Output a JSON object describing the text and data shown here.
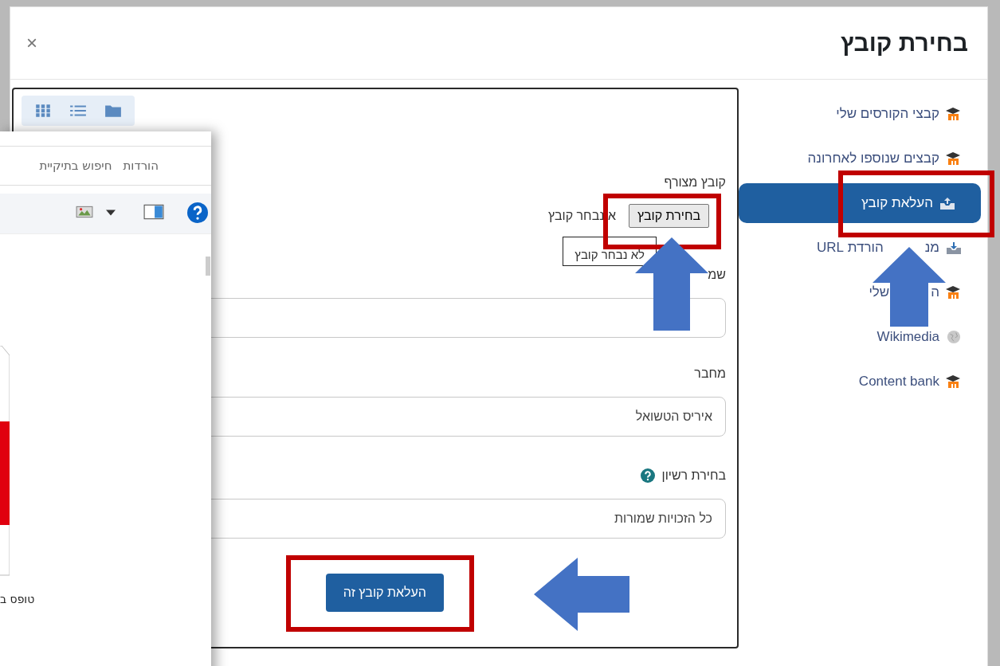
{
  "dialog": {
    "title": "בחירת קובץ",
    "close": "×"
  },
  "sidebar": [
    {
      "parts": [
        "קבצי הקורסים שלי"
      ],
      "kind": "hat",
      "selected": false
    },
    {
      "parts": [
        "קבצים שנוספו לאחרונה"
      ],
      "kind": "hat",
      "selected": false
    },
    {
      "parts": [
        "העלאת קובץ"
      ],
      "kind": "upload",
      "selected": true
    },
    {
      "parts": [
        "מנ",
        "הורדת URL"
      ],
      "kind": "download",
      "selected": false
    },
    {
      "parts": [
        "ה",
        "שלי"
      ],
      "kind": "hat",
      "selected": false
    },
    {
      "parts": [
        "Wikimedia"
      ],
      "kind": "globe",
      "selected": false
    },
    {
      "parts": [
        "Content bank"
      ],
      "kind": "hat",
      "selected": false
    }
  ],
  "form": {
    "attachment_label": "קובץ מצורף",
    "choose_button": "בחירת קובץ",
    "no_file": "א נבחר קובץ",
    "tooltip": "לא נבחר קובץ",
    "save_as_label": "שמ",
    "author_label": "מחבר",
    "author_value": "איריס הטשואל",
    "license_label": "בחירת רשיון",
    "license_value": "כל הזכויות שמורות",
    "upload_button": "העלאת קובץ זה"
  },
  "file_window": {
    "breadcrumb": "הורדות",
    "search_placeholder": "חיפוש בתיקיית",
    "file_label": "טופס ב"
  }
}
